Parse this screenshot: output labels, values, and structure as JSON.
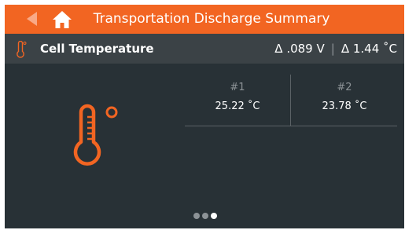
{
  "header": {
    "title": "Transportation Discharge Summary"
  },
  "subheader": {
    "label": "Cell Temperature",
    "voltage_delta": "Δ .089 V",
    "separator": "|",
    "temp_delta": "Δ 1.44 ˚C"
  },
  "cells": [
    {
      "label": "#1",
      "value": "25.22 ˚C"
    },
    {
      "label": "#2",
      "value": "23.78 ˚C"
    }
  ],
  "pager": {
    "count": 3,
    "active_index": 2
  },
  "colors": {
    "accent": "#f26522",
    "background": "#283136",
    "subbar": "#3b4246"
  },
  "icons": {
    "back": "back-arrow-icon",
    "home": "home-icon",
    "thermometer": "thermometer-icon"
  }
}
